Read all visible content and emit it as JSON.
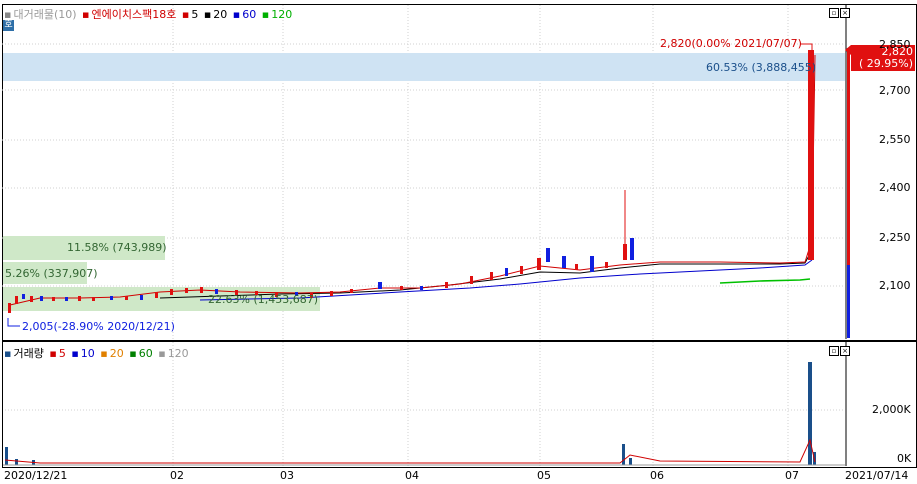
{
  "price_legend": {
    "volume_tag": "대거래물(10)",
    "name": "엔에이치스팩18호",
    "ma": [
      {
        "label": "5",
        "color": "#d00000"
      },
      {
        "label": "20",
        "color": "#000000"
      },
      {
        "label": "60",
        "color": "#0000cc"
      },
      {
        "label": "120",
        "color": "#00b000"
      }
    ]
  },
  "volume_legend": {
    "name": "거래량",
    "ma": [
      {
        "label": "5",
        "color": "#d00000"
      },
      {
        "label": "10",
        "color": "#0000cc"
      },
      {
        "label": "20",
        "color": "#e08000"
      },
      {
        "label": "60",
        "color": "#008000"
      },
      {
        "label": "120",
        "color": "#999999"
      }
    ]
  },
  "side_toggle": "호",
  "annotations": {
    "high": "2,820(0.00% 2021/07/07)",
    "low": "2,005(-28.90% 2020/12/21)",
    "band_top": "60.53% (3,888,455)",
    "band_mid": "11.58% (743,989)",
    "band_mid2": "5.26% (337,907)",
    "band_low": "22.63% (1,453,687)"
  },
  "current_price": {
    "price": "2,820",
    "change": "( 29.95%)"
  },
  "price_axis": [
    "2,850",
    "2,700",
    "2,550",
    "2,400",
    "2,250",
    "2,100"
  ],
  "volume_axis": [
    "2,000K",
    "0K"
  ],
  "date_axis": [
    "2020/12/21",
    "02",
    "03",
    "04",
    "05",
    "06",
    "07",
    "2021/07/14"
  ],
  "colors": {
    "up": "#e01010",
    "down": "#1020e0",
    "band": "#cfe3f3",
    "band_green": "#cfe8c8"
  },
  "chart_data": {
    "type": "candlestick",
    "title": "엔에이치스팩18호",
    "x_range": [
      "2020/12/21",
      "2021/07/14"
    ],
    "y_range": [
      2005,
      2850
    ],
    "high": {
      "value": 2820,
      "date": "2021/07/07"
    },
    "low": {
      "value": 2005,
      "date": "2020/12/21"
    },
    "last": 2820,
    "volume_peak_approx_k": 3900
  }
}
